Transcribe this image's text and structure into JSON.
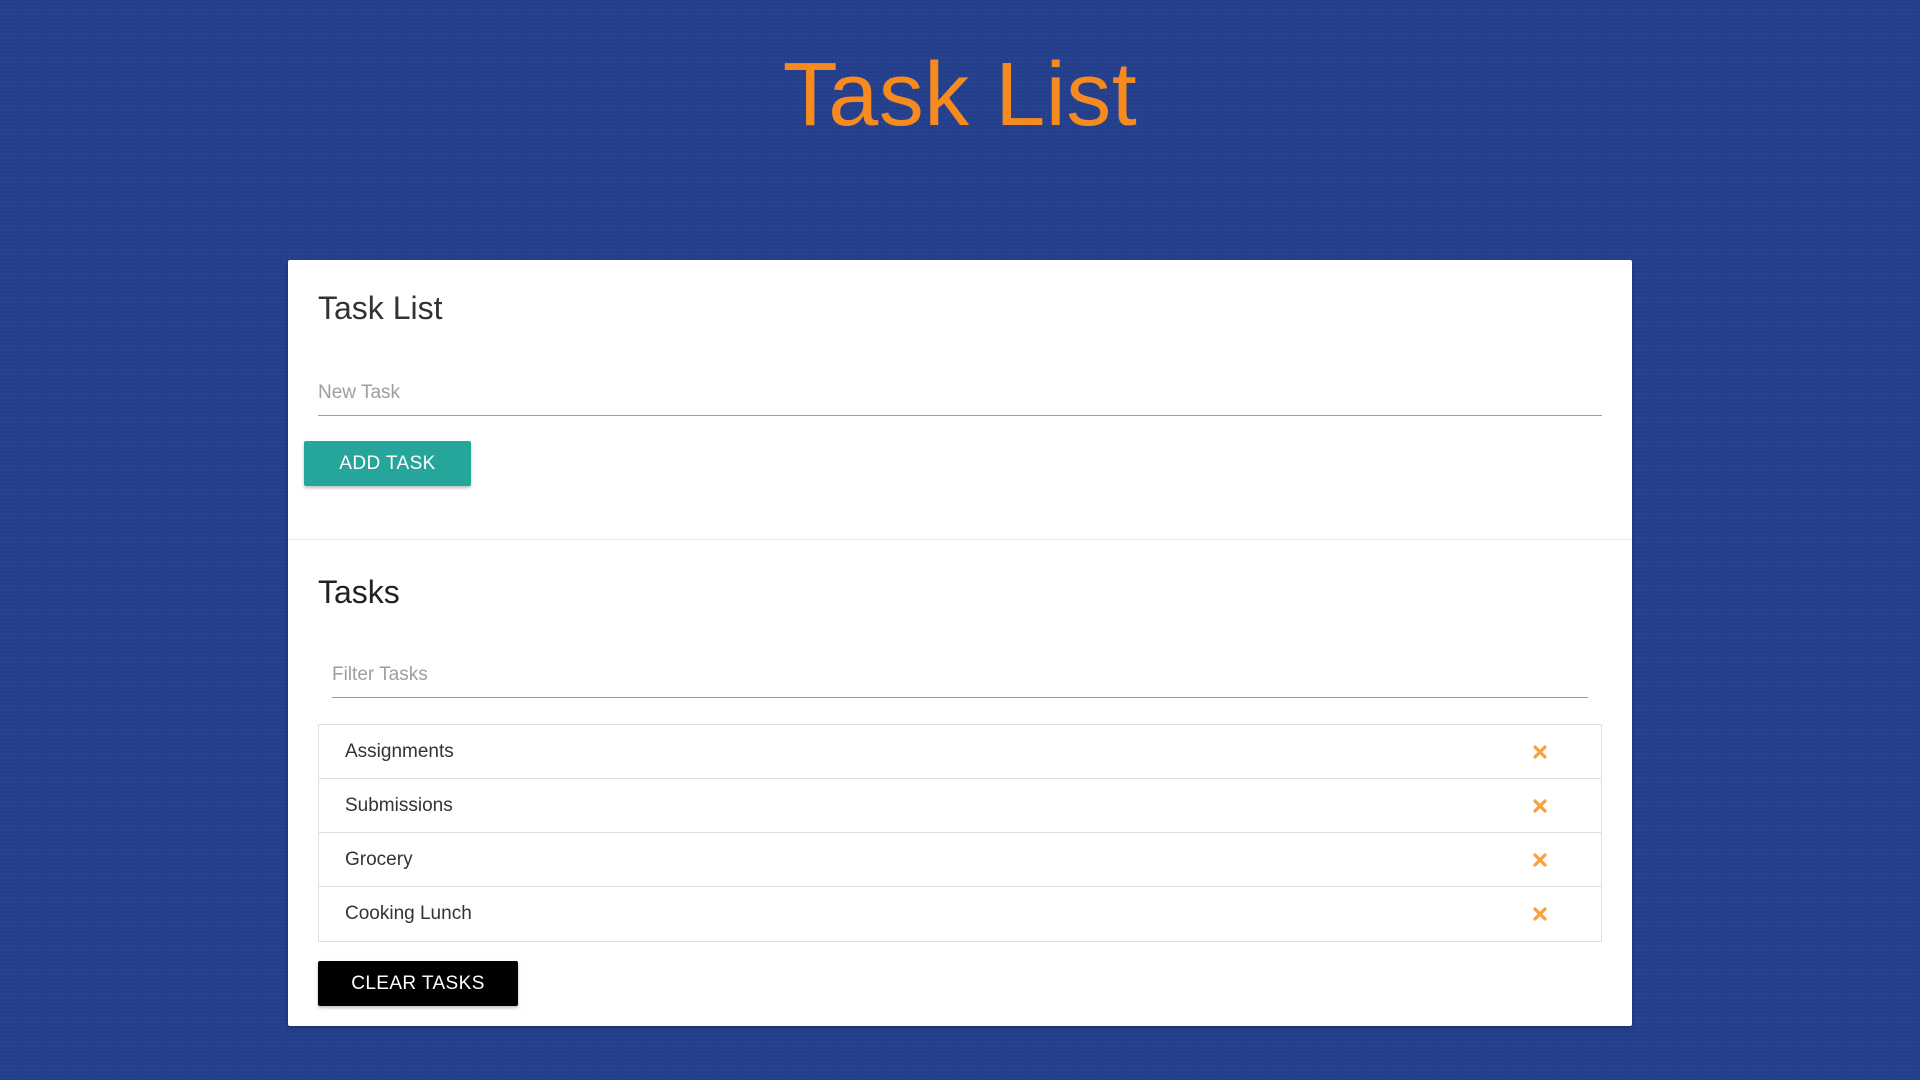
{
  "header": {
    "title": "Task List"
  },
  "card": {
    "title": "Task List",
    "new_task": {
      "placeholder": "New Task",
      "value": ""
    },
    "add_button_label": "ADD TASK",
    "tasks_heading": "Tasks",
    "filter": {
      "placeholder": "Filter Tasks",
      "value": ""
    },
    "tasks": [
      {
        "label": "Assignments",
        "delete_icon": "close-x-icon"
      },
      {
        "label": "Submissions",
        "delete_icon": "close-x-icon"
      },
      {
        "label": "Grocery",
        "delete_icon": "close-x-icon"
      },
      {
        "label": "Cooking Lunch",
        "delete_icon": "close-x-icon"
      }
    ],
    "clear_button_label": "CLEAR TASKS"
  },
  "colors": {
    "background": "#243f8c",
    "title": "#f68a1e",
    "add_button": "#26a69a",
    "clear_button": "#000000",
    "delete_icon": "#f9a03f"
  }
}
